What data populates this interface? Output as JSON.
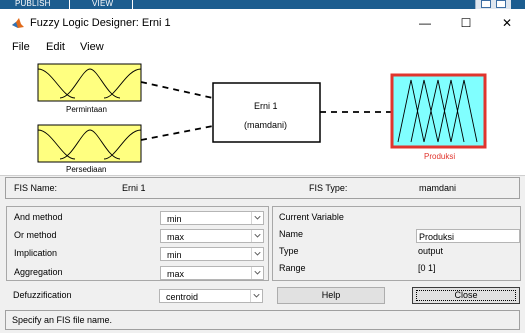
{
  "toolstrip": {
    "tabs": [
      "PUBLISH",
      "VIEW"
    ]
  },
  "window": {
    "title": "Fuzzy Logic Designer: Erni 1",
    "controls": {
      "minimize": "—",
      "maximize": "☐",
      "close": "✕"
    }
  },
  "menu": [
    "File",
    "Edit",
    "View"
  ],
  "diagram": {
    "inputs": [
      "Permintaan",
      "Persediaan"
    ],
    "system": {
      "name": "Erni 1",
      "type": "(mamdani)"
    },
    "output": "Produksi",
    "colors": {
      "input_fill": "#ffff80",
      "output_fill": "#80ffff",
      "output_selected_border": "#e0352e"
    }
  },
  "fis_info": {
    "name_label": "FIS Name:",
    "name_value": "Erni 1",
    "type_label": "FIS Type:",
    "type_value": "mamdani"
  },
  "methods": [
    {
      "label": "And method",
      "value": "min"
    },
    {
      "label": "Or method",
      "value": "max"
    },
    {
      "label": "Implication",
      "value": "min"
    },
    {
      "label": "Aggregation",
      "value": "max"
    },
    {
      "label": "Defuzzification",
      "value": "centroid"
    }
  ],
  "current_variable": {
    "title": "Current Variable",
    "name_label": "Name",
    "name_value": "Produksi",
    "type_label": "Type",
    "type_value": "output",
    "range_label": "Range",
    "range_value": "[0 1]"
  },
  "buttons": {
    "help": "Help",
    "close": "Close"
  },
  "status": "Specify an FIS file name."
}
